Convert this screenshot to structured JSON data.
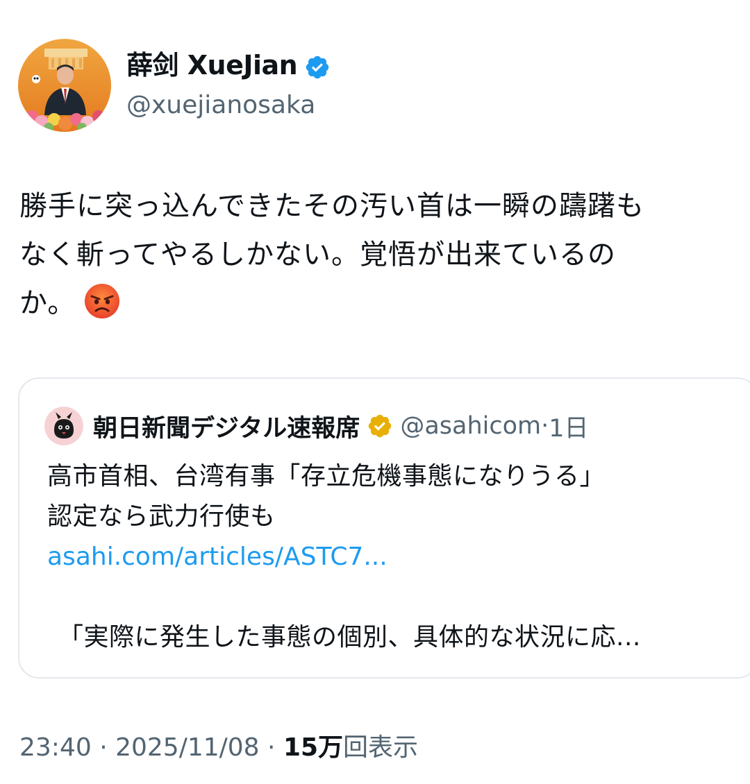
{
  "author": {
    "display_name": "薛剑 XueJian",
    "handle": "@xuejianosaka",
    "verified_color": "#1d9bf0"
  },
  "tweet": {
    "text": "勝手に突っ込んできたその汚い首は一瞬の躊躇も\nなく斬ってやるしかない。覚悟が出来ているの\nか。",
    "emoji": "angry-face"
  },
  "quote": {
    "name": "朝日新聞デジタル速報席",
    "verified_color": "#e8b007",
    "handle": "@asahicom",
    "separator": "·",
    "time": "1日",
    "text": "高市首相、台湾有事「存立危機事態になりうる」\n認定なら武力行使も",
    "link": "asahi.com/articles/ASTC7...",
    "excerpt": "「実際に発生した事態の個別、具体的な状況に応..."
  },
  "meta": {
    "time": "23:40",
    "sep1": " · ",
    "date": "2025/11/08",
    "sep2": " · ",
    "views_count": "15万",
    "views_label": "回表示"
  }
}
